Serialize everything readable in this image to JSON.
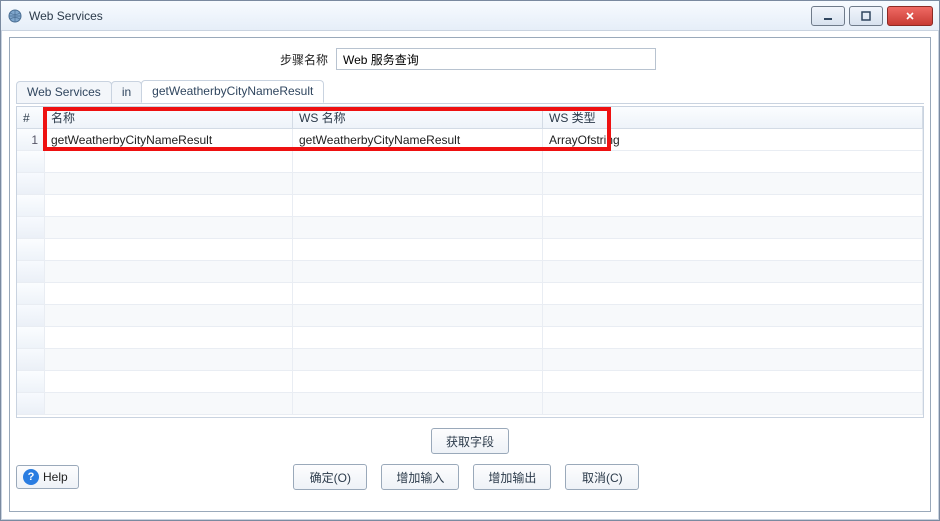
{
  "window": {
    "title": "Web Services"
  },
  "step": {
    "label": "步骤名称",
    "value": "Web 服务查询"
  },
  "breadcrumb": {
    "items": [
      {
        "label": "Web Services"
      },
      {
        "label": "in"
      },
      {
        "label": "getWeatherbyCityNameResult"
      }
    ]
  },
  "table": {
    "headers": {
      "index": "#",
      "name": "名称",
      "wsname": "WS 名称",
      "wstype": "WS 类型"
    },
    "rows": [
      {
        "num": "1",
        "name": "getWeatherbyCityNameResult",
        "wsname": "getWeatherbyCityNameResult",
        "wstype": "ArrayOfstring"
      }
    ]
  },
  "buttons": {
    "fetch": "获取字段",
    "ok": "确定(O)",
    "add_in": "增加输入",
    "add_out": "增加输出",
    "cancel": "取消(C)",
    "help": "Help"
  }
}
